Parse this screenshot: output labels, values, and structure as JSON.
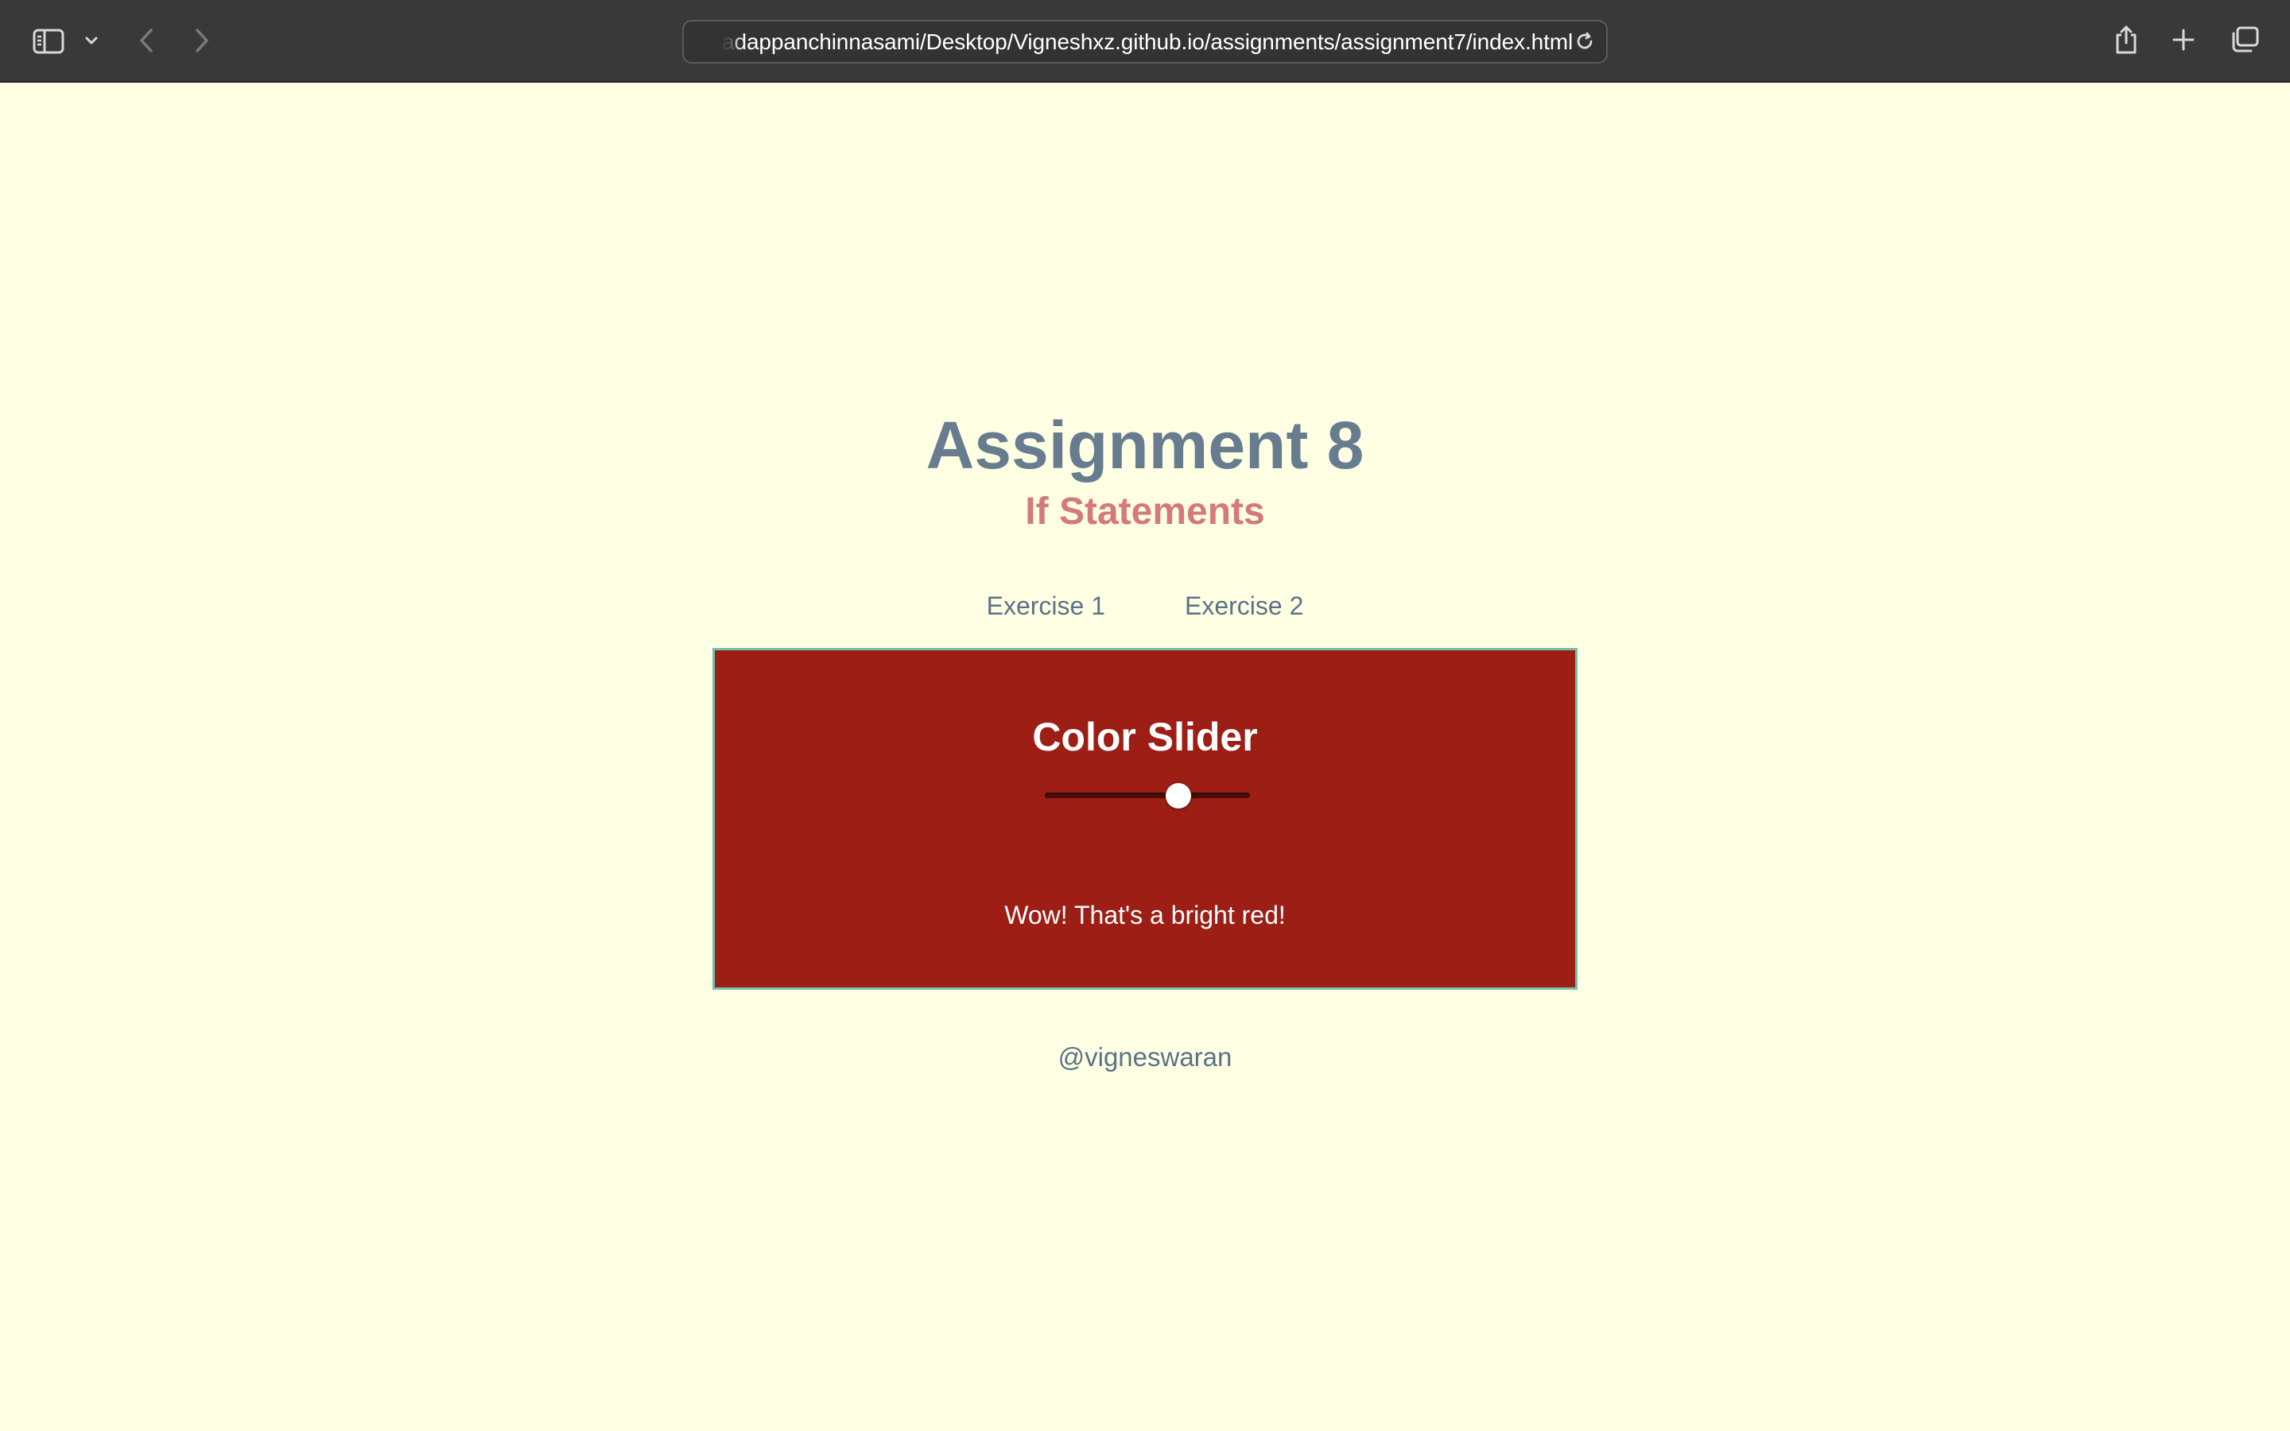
{
  "browser": {
    "url_prefix": "a",
    "url": "dappanchinnasami/Desktop/Vigneshxz.github.io/assignments/assignment7/index.html",
    "icons": {
      "sidebar": "sidebar-icon",
      "sidebar_menu": "chevron-down-icon",
      "back": "back-arrow-icon",
      "forward": "forward-arrow-icon",
      "reload": "reload-icon",
      "share": "share-icon",
      "new_tab": "plus-icon",
      "tabs": "tab-overview-icon"
    }
  },
  "page": {
    "title": "Assignment 8",
    "subtitle": "If Statements",
    "nav": [
      {
        "label": "Exercise 1"
      },
      {
        "label": "Exercise 2"
      }
    ],
    "card": {
      "title": "Color Slider",
      "slider_fraction": 0.65,
      "message": "Wow! That's a bright red!",
      "background_color": "#9C1E15",
      "border_color": "#6FC2AE"
    },
    "footer": "@vigneswaran"
  },
  "colors": {
    "page_background": "#FFFFE4",
    "title": "#677D8F",
    "subtitle": "#D57979",
    "link": "#5B7286"
  }
}
